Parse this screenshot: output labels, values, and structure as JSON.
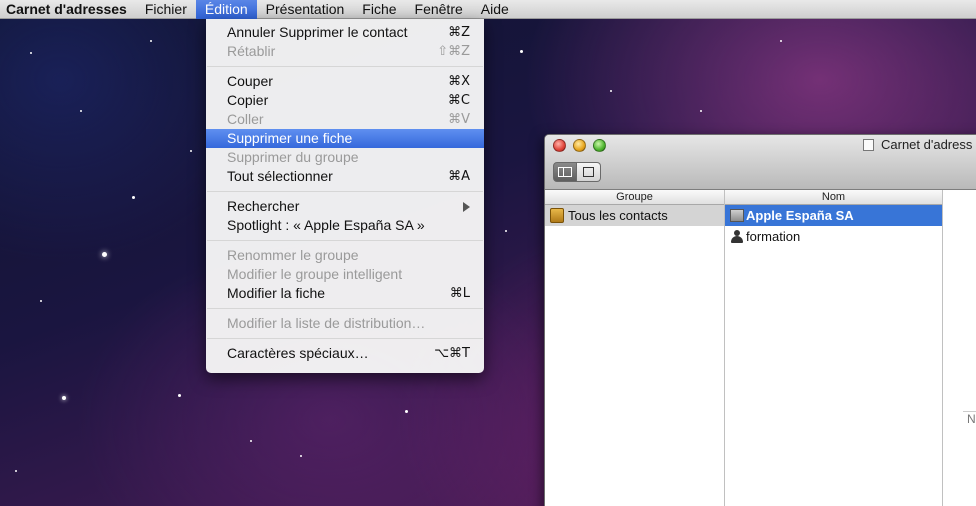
{
  "menubar": {
    "app": "Carnet d'adresses",
    "items": [
      "Fichier",
      "Édition",
      "Présentation",
      "Fiche",
      "Fenêtre",
      "Aide"
    ]
  },
  "edit_menu": {
    "groups": [
      [
        {
          "label": "Annuler Supprimer le contact",
          "shortcut": "⌘Z",
          "enabled": true
        },
        {
          "label": "Rétablir",
          "shortcut": "⇧⌘Z",
          "enabled": false
        }
      ],
      [
        {
          "label": "Couper",
          "shortcut": "⌘X",
          "enabled": true
        },
        {
          "label": "Copier",
          "shortcut": "⌘C",
          "enabled": true
        },
        {
          "label": "Coller",
          "shortcut": "⌘V",
          "enabled": false
        },
        {
          "label": "Supprimer une fiche",
          "shortcut": "",
          "enabled": true,
          "selected": true
        },
        {
          "label": "Supprimer du groupe",
          "shortcut": "",
          "enabled": false
        },
        {
          "label": "Tout sélectionner",
          "shortcut": "⌘A",
          "enabled": true
        }
      ],
      [
        {
          "label": "Rechercher",
          "shortcut": "",
          "enabled": true,
          "submenu": true
        },
        {
          "label": "Spotlight : « Apple España SA »",
          "shortcut": "",
          "enabled": true
        }
      ],
      [
        {
          "label": "Renommer le groupe",
          "shortcut": "",
          "enabled": false
        },
        {
          "label": "Modifier le groupe intelligent",
          "shortcut": "",
          "enabled": false
        },
        {
          "label": "Modifier la fiche",
          "shortcut": "⌘L",
          "enabled": true
        }
      ],
      [
        {
          "label": "Modifier la liste de distribution…",
          "shortcut": "",
          "enabled": false
        }
      ],
      [
        {
          "label": "Caractères spéciaux…",
          "shortcut": "⌥⌘T",
          "enabled": true
        }
      ]
    ]
  },
  "window": {
    "title": "Carnet d'adress",
    "columns": {
      "groups_header": "Groupe",
      "names_header": "Nom"
    },
    "groups": [
      "Tous les contacts"
    ],
    "contacts": [
      {
        "name": "Apple España SA",
        "kind": "company",
        "selected": true
      },
      {
        "name": "formation",
        "kind": "person",
        "selected": false
      }
    ],
    "card_fragment": "N"
  }
}
